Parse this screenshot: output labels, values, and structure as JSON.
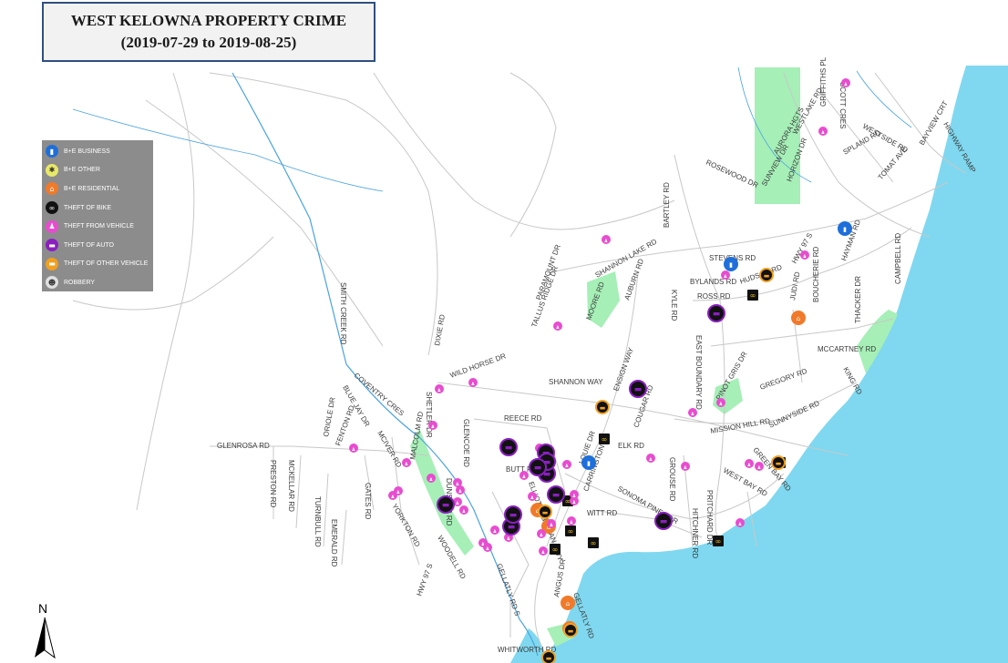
{
  "map": {
    "title_line1": "WEST KELOWNA PROPERTY CRIME",
    "title_line2": "(2019-07-29 to 2019-08-25)",
    "north_label": "N",
    "colors": {
      "water": "#7fd8ef",
      "park": "#a6efb7",
      "road": "#c8c8c8",
      "creek": "#4aa3df",
      "legend_bg": "#8c8c8c"
    }
  },
  "legend": {
    "items": [
      {
        "label": "B+E BUSINESS",
        "color": "#1e6fd9",
        "icon": "building-icon",
        "glyph": "▮"
      },
      {
        "label": "B+E OTHER",
        "color": "#e8e86a",
        "icon": "asterisk-icon",
        "glyph": "✱"
      },
      {
        "label": "B+E RESIDENTIAL",
        "color": "#f07a2a",
        "icon": "house-icon",
        "glyph": "⌂"
      },
      {
        "label": "THEFT OF BIKE",
        "color": "#111111",
        "icon": "bike-icon",
        "glyph": "∞"
      },
      {
        "label": "THEFT FROM VEHICLE",
        "color": "#e84ccf",
        "icon": "person-icon",
        "glyph": "♟"
      },
      {
        "label": "THEFT OF AUTO",
        "color": "#8a1fc0",
        "icon": "car-icon",
        "glyph": "▬"
      },
      {
        "label": "THEFT OF OTHER VEHICLE",
        "color": "#f0a020",
        "icon": "truck-icon",
        "glyph": "▬"
      },
      {
        "label": "ROBBERY",
        "color": "#e0e0e0",
        "icon": "mask-icon",
        "glyph": "☻"
      }
    ]
  },
  "roads": [
    "GLENROSA RD",
    "PRESTON RD",
    "MCKELLAR RD",
    "TURNBULL RD",
    "EMERALD RD",
    "FENTON RD",
    "GATES RD",
    "ORIOLE DR",
    "BLUE JAY DR",
    "MCIVER RD",
    "COVENTRY CRES",
    "SMITH CREEK RD",
    "DIXIE RD",
    "SHETLER DR",
    "WILD HORSE DR",
    "GLENCOE RD",
    "REECE RD",
    "MALCOLM RD",
    "DUNSTER RD",
    "YORKTON RD",
    "WOODELL RD",
    "HWY 97 S",
    "GELLATLY RD S",
    "BUTT RD",
    "ELLIOTT RD",
    "SHANNON WAY",
    "ENSIGN WAY",
    "AUBURN RD",
    "PARAMOUNT DR",
    "TALLUS RIDGE DR",
    "MOORE RD",
    "SHANNON LAKE RD",
    "BARTLEY RD",
    "KYLE RD",
    "EAST BOUNDARY RD",
    "COUGAR RD",
    "ELK RD",
    "LOUIE DR",
    "CARRINGTON RD",
    "WITT RD",
    "SONOMA PINES DR",
    "GROUSE RD",
    "PRITCHARD DR",
    "HITCHNER RD",
    "ANGUS DR",
    "GELLATLY RD",
    "WHITWORTH RD",
    "BYLANDS RD",
    "STEVENS RD",
    "HUDSON RD",
    "ROSS RD",
    "MISSION HILL RD",
    "PINOT GRIS DR",
    "GREGORY RD",
    "KING RD",
    "SUNNYSIDE RD",
    "MCCARTNEY RD",
    "WEST BAY RD",
    "GREEN BAY RD",
    "BOUCHERIE RD",
    "THACKER DR",
    "CAMPBELL RD",
    "HAYMAN RD",
    "TOMAT AVE",
    "SPLAND RD",
    "WESTSIDE RD",
    "BAYVIEW CRT",
    "HIGHWAY RAMP",
    "ROSEWOOD DR",
    "SUNVIEW DR",
    "AURORA HGTS",
    "HORIZON DR",
    "WESTLAKE RD",
    "GRIFFITHS PL",
    "SCOTT CRES",
    "NAGAN HWY",
    "HWY 97 S",
    "JUDI RD"
  ],
  "incidents": [
    {
      "type": "B+E BUSINESS",
      "n": 3
    },
    {
      "type": "B+E RESIDENTIAL",
      "n": 5
    },
    {
      "type": "THEFT OF BIKE",
      "n": 8
    },
    {
      "type": "THEFT FROM VEHICLE",
      "n": 40
    },
    {
      "type": "THEFT OF AUTO",
      "n": 12
    },
    {
      "type": "THEFT OF OTHER VEHICLE",
      "n": 6
    }
  ]
}
